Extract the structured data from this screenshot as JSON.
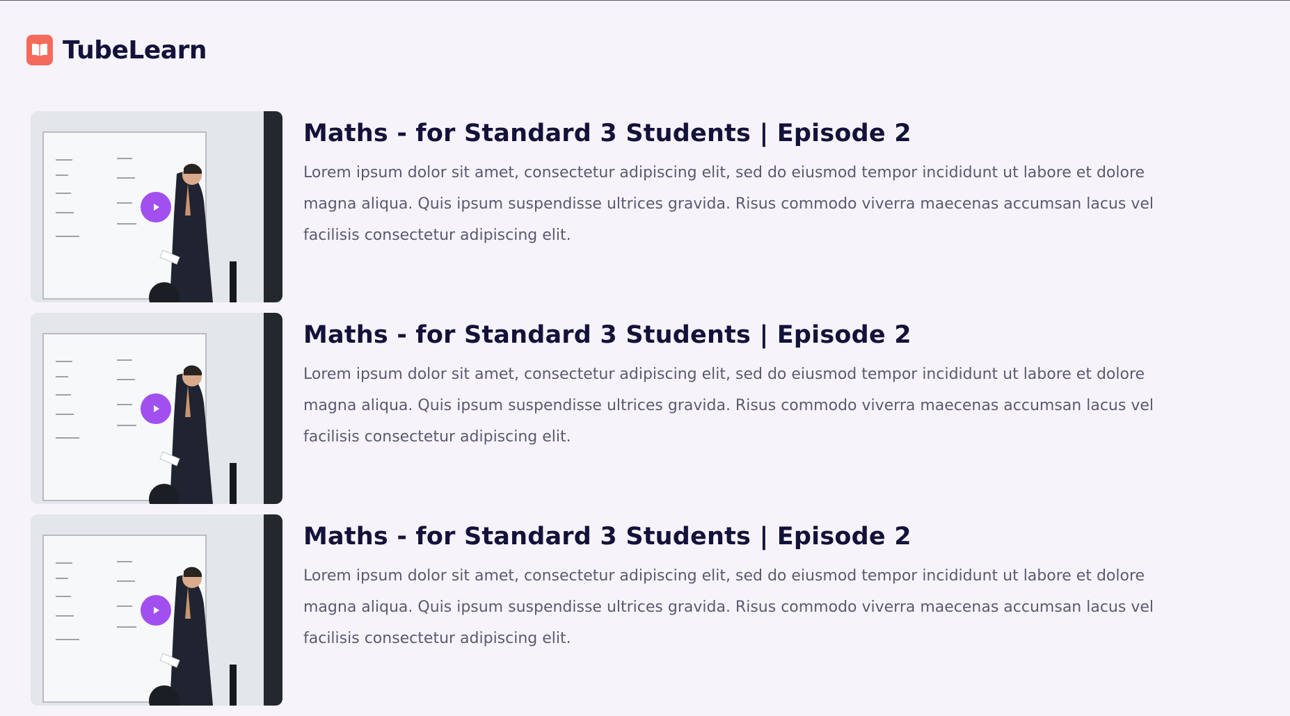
{
  "brand": {
    "name": "TubeLearn",
    "logo_icon": "open-book-icon",
    "logo_color": "#f46b5c"
  },
  "colors": {
    "background": "#f6f4fa",
    "heading": "#14123a",
    "body_text": "#5b5970",
    "play_button": "#a24ff0"
  },
  "videos": [
    {
      "title": "Maths - for Standard 3 Students | Episode 2",
      "description": "Lorem ipsum dolor sit amet, consectetur adipiscing elit, sed do eiusmod tempor incididunt ut labore et dolore magna aliqua. Quis ipsum suspendisse ultrices gravida. Risus commodo viverra maecenas accumsan lacus vel facilisis consectetur adipiscing elit."
    },
    {
      "title": "Maths - for Standard 3 Students | Episode 2",
      "description": "Lorem ipsum dolor sit amet, consectetur adipiscing elit, sed do eiusmod tempor incididunt ut labore et dolore magna aliqua. Quis ipsum suspendisse ultrices gravida. Risus commodo viverra maecenas accumsan lacus vel facilisis consectetur adipiscing elit."
    },
    {
      "title": "Maths - for Standard 3 Students | Episode 2",
      "description": "Lorem ipsum dolor sit amet, consectetur adipiscing elit, sed do eiusmod tempor incididunt ut labore et dolore magna aliqua. Quis ipsum suspendisse ultrices gravida. Risus commodo viverra maecenas accumsan lacus vel facilisis consectetur adipiscing elit."
    }
  ]
}
